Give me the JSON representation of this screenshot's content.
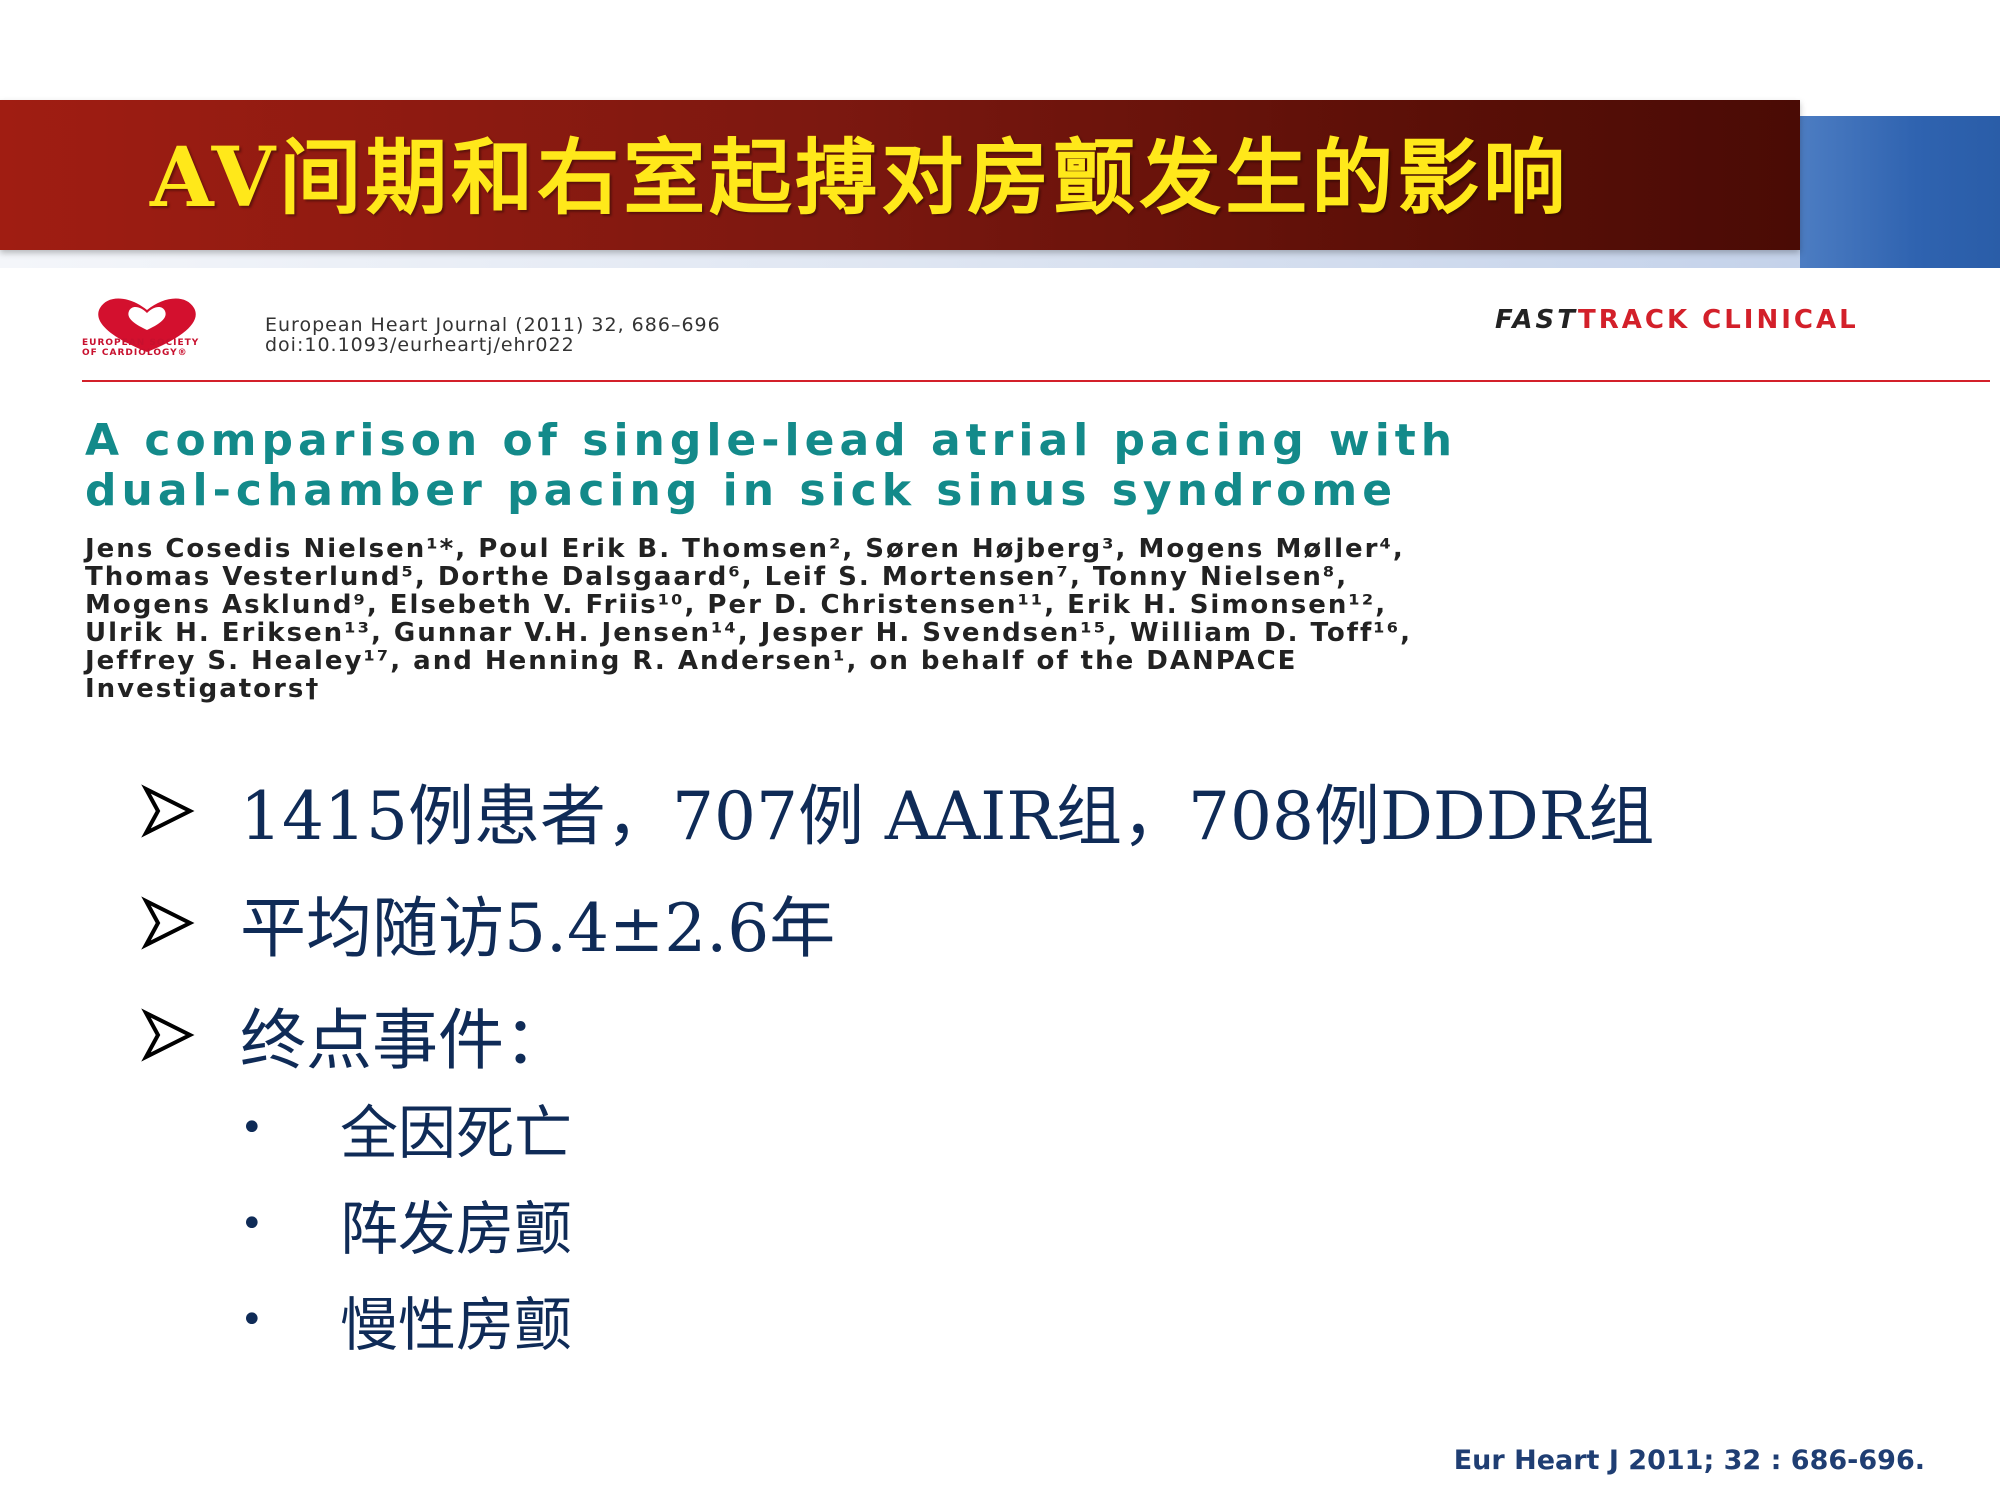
{
  "slide": {
    "title": "AV间期和右室起搏对房颤发生的影响"
  },
  "paper": {
    "society_logo_text": "EUROPEAN SOCIETY OF CARDIOLOGY®",
    "journal": "European Heart Journal (2011) 32, 686–696",
    "doi": "doi:10.1093/eurheartj/ehr022",
    "section_fast": "FAST",
    "section_track": "TRACK CLINICAL",
    "title_line1": "A comparison of single-lead atrial pacing with",
    "title_line2": "dual-chamber pacing in sick sinus syndrome",
    "authors_line1": "Jens Cosedis Nielsen¹*, Poul Erik B. Thomsen², Søren Højberg³, Mogens Møller⁴,",
    "authors_line2": "Thomas Vesterlund⁵, Dorthe Dalsgaard⁶, Leif S. Mortensen⁷, Tonny Nielsen⁸,",
    "authors_line3": "Mogens Asklund⁹, Elsebeth V. Friis¹⁰, Per D. Christensen¹¹, Erik H. Simonsen¹²,",
    "authors_line4": "Ulrik H. Eriksen¹³, Gunnar V.H. Jensen¹⁴, Jesper H. Svendsen¹⁵, William D. Toff¹⁶,",
    "authors_line5": "Jeffrey S. Healey¹⁷, and Henning R. Andersen¹, on behalf of the DANPACE",
    "authors_line6": "Investigators†"
  },
  "bullets": [
    {
      "text": "1415例患者，707例 AAIR组，708例DDDR组",
      "icon": "arrow-bullet-icon"
    },
    {
      "text": "平均随访5.4±2.6年",
      "icon": "arrow-bullet-icon"
    },
    {
      "text": "终点事件：",
      "icon": "arrow-bullet-icon"
    }
  ],
  "sub_bullets": [
    {
      "marker": "•",
      "text": "全因死亡"
    },
    {
      "marker": "•",
      "text": "阵发房颤"
    },
    {
      "marker": "•",
      "text": "慢性房颤"
    }
  ],
  "citation": "Eur Heart J 2011; 32 : 686-696.",
  "colors": {
    "title_yellow": "#ffe81a",
    "banner_red": "#a01d12",
    "banner_blue": "#2f63b0",
    "paper_title_teal": "#138a8a",
    "body_navy": "#0f2b57",
    "accent_red": "#d3202a"
  }
}
